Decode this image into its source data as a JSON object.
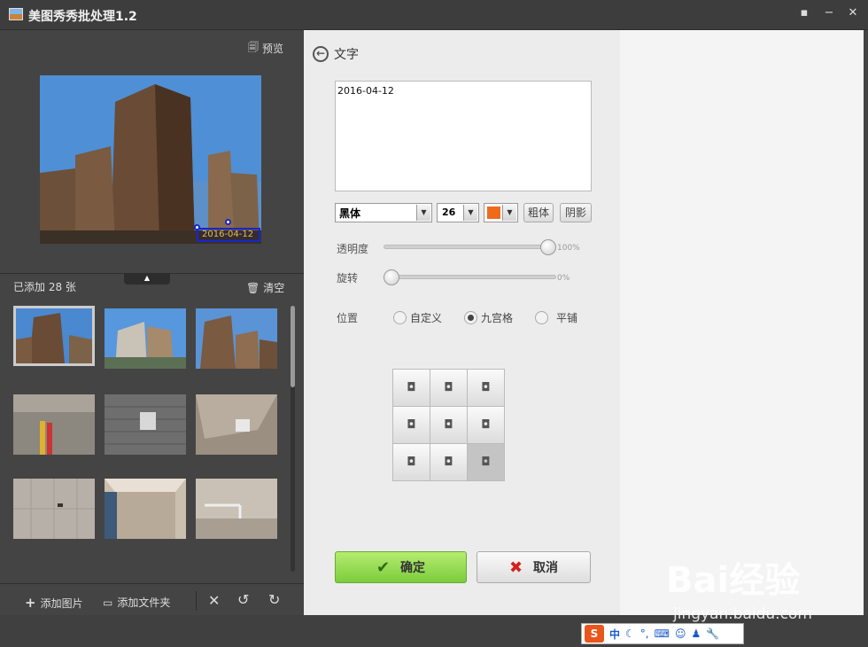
{
  "titlebar": {
    "title": "美图秀秀批处理1.2"
  },
  "left": {
    "preview_label": "预览",
    "stamp_text": "2016-04-12",
    "added_count": "已添加 28 张",
    "clear_label": "清空",
    "bottom": {
      "add_image": "添加图片",
      "add_folder": "添加文件夹"
    }
  },
  "mid": {
    "back_label": "文字",
    "text_content": "2016-04-12",
    "font": "黑体",
    "size": "26",
    "bold_label": "粗体",
    "shadow_label": "阴影",
    "opacity_label": "透明度",
    "opacity_value": "100%",
    "opacity_fraction": 1.0,
    "rotate_label": "旋转",
    "rotate_value": "0%",
    "rotate_fraction": 0.0,
    "position_label": "位置",
    "radios": [
      "自定义",
      "九宫格",
      "平铺"
    ],
    "radio_selected": "九宫格",
    "ok_label": "确定",
    "cancel_label": "取消"
  },
  "colors": {
    "text_color": "#f06a1c",
    "ok_green": "#8bd44a"
  },
  "ime": {
    "mode": "中"
  },
  "watermark": {
    "brand": "Bai经验",
    "url": "jingyan.baidu.com"
  }
}
